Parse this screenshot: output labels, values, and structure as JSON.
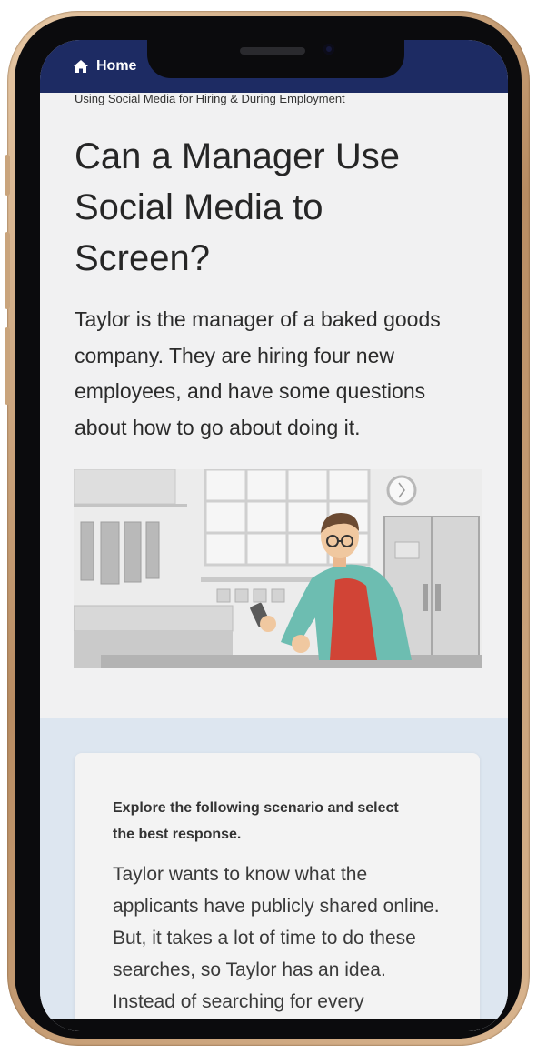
{
  "nav": {
    "home_label": "Home",
    "home_icon": "home-icon"
  },
  "breadcrumb": "Using Social Media for Hiring & During Employment",
  "page": {
    "title": "Can a Manager Use Social Media to Screen?",
    "intro": "Taylor is the manager of a baked goods company. They are hiring four new employees, and have some questions about how to go about doing it."
  },
  "scenario": {
    "prompt": "Explore the following scenario and select the best response.",
    "text": "Taylor wants to know what the applicants have publicly shared online. But, it takes a lot of time to do these searches, so Taylor has an idea. Instead of searching for every"
  },
  "colors": {
    "nav_bar": "#1d2b63",
    "page_bg": "#f1f1f2",
    "scenario_bg": "#dde6f0",
    "phone_frame": "#d4ae86"
  }
}
